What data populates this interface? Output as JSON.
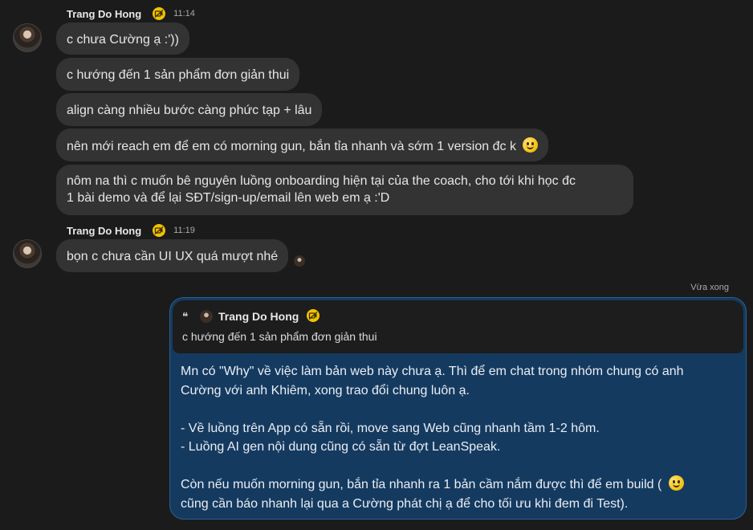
{
  "messages": [
    {
      "sender": "Trang Do Hong",
      "time": "11:14",
      "bubbles": [
        "c chưa Cường ạ :'))",
        "c hướng đến 1 sản phẩm đơn giản thui",
        "align càng nhiều bước càng phức tạp + lâu",
        "nên mới reach em để em có morning gun, bắn tỉa nhanh và sớm 1 version đc k",
        "nôm na thì c muốn bê nguyên luồng onboarding hiện tại của the coach, cho tới khi học đc",
        "1 bài demo và để lại SĐT/sign-up/email lên web em ạ :'D"
      ]
    },
    {
      "sender": "Trang Do Hong",
      "time": "11:19",
      "bubbles": [
        "bọn c chưa cần UI UX quá mượt nhé"
      ]
    }
  ],
  "reply": {
    "timestamp": "Vừa xong",
    "quote": {
      "sender": "Trang Do Hong",
      "text": "c hướng đến 1 sản phẩm đơn giản thui"
    },
    "body": {
      "p1_l1": "Mn có \"Why\" về việc làm bản web này chưa ạ. Thì để em chat trong nhóm chung có anh",
      "p1_l2": "Cường với anh Khiêm, xong trao đổi chung luôn ạ.",
      "p2_l1": "- Về luồng trên App có sẵn rồi, move sang Web cũng nhanh tầm 1-2 hôm.",
      "p2_l2": "- Luồng AI gen nội dung cũng có sẵn từ đợt LeanSpeak.",
      "p3_l1": "Còn nếu muốn morning gun, bắn tỉa nhanh ra 1 bản cầm nắm được thì để em build (",
      "p3_l2": "cũng cần báo nhanh lại qua a Cường phát chị ạ để cho tối ưu khi đem đi Test)."
    }
  },
  "icons": {
    "badge": "no-camera-badge-icon",
    "emoji": "slightly-smiling-face-emoji",
    "quote": "quote-icon"
  },
  "colors": {
    "background": "#1b1b1b",
    "bubble": "#333333",
    "reply_bubble": "#153a5f",
    "reply_border": "#2b5f92",
    "badge": "#f2c200"
  }
}
